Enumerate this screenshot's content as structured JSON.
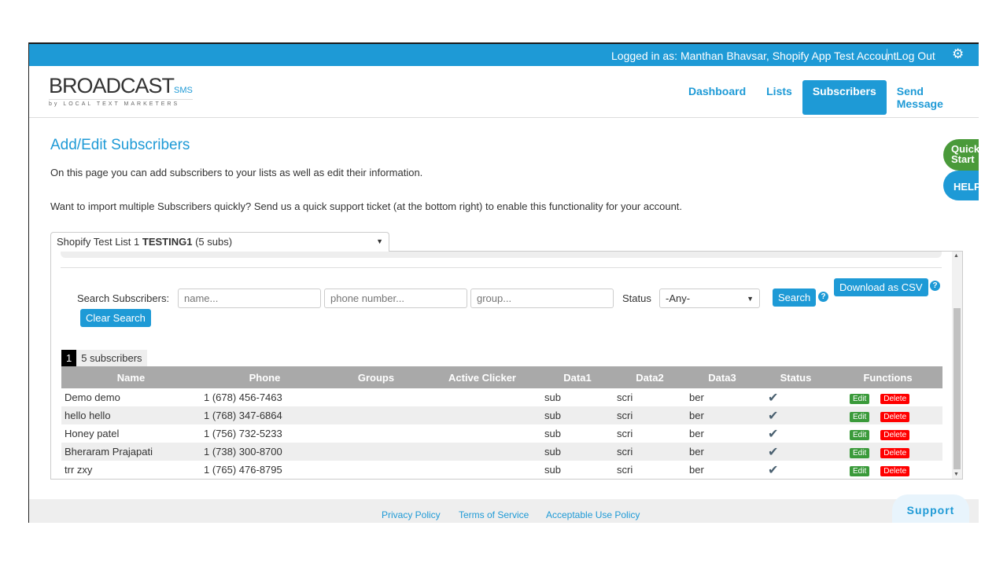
{
  "topbar": {
    "logged_in": "Logged in as: Manthan Bhavsar, Shopify App Test Account",
    "logout": "Log Out",
    "settings_icon": "gear-icon"
  },
  "logo": {
    "brand": "BROADCAST",
    "suffix": "SMS",
    "tagline": "by LOCAL TEXT MARKETERS"
  },
  "nav": [
    {
      "label": "Dashboard"
    },
    {
      "label": "Lists"
    },
    {
      "label": "Subscribers",
      "active": true
    },
    {
      "label": "Send Message"
    }
  ],
  "page": {
    "title": "Add/Edit Subscribers",
    "intro": "On this page you can add subscribers to your lists as well as edit their information.",
    "import_note": "Want to import multiple Subscribers quickly? Send us a quick support ticket (at the bottom right) to enable this functionality for your account."
  },
  "side": {
    "quick_start": "Quick Start",
    "help": "HELP"
  },
  "list_select": {
    "prefix": "Shopify Test List 1",
    "name": "TESTING1",
    "suffix": "(5 subs)"
  },
  "search": {
    "label": "Search Subscribers:",
    "name_placeholder": "name...",
    "phone_placeholder": "phone number...",
    "group_placeholder": "group...",
    "status_label": "Status",
    "status_value": "-Any-",
    "search_button": "Search",
    "csv_button": "Download as CSV",
    "clear_button": "Clear Search"
  },
  "pagination": {
    "page": "1",
    "count": "5 subscribers"
  },
  "table": {
    "columns": [
      "Name",
      "Phone",
      "Groups",
      "Active Clicker",
      "Data1",
      "Data2",
      "Data3",
      "Status",
      "Functions"
    ],
    "rows": [
      {
        "name": "Demo demo",
        "phone": "1 (678) 456-7463",
        "groups": "",
        "active": "",
        "d1": "sub",
        "d2": "scri",
        "d3": "ber",
        "status": "✔"
      },
      {
        "name": "hello hello",
        "phone": "1 (768) 347-6864",
        "groups": "",
        "active": "",
        "d1": "sub",
        "d2": "scri",
        "d3": "ber",
        "status": "✔"
      },
      {
        "name": "Honey patel",
        "phone": "1 (756) 732-5233",
        "groups": "",
        "active": "",
        "d1": "sub",
        "d2": "scri",
        "d3": "ber",
        "status": "✔"
      },
      {
        "name": "Bheraram Prajapati",
        "phone": "1 (738) 300-8700",
        "groups": "",
        "active": "",
        "d1": "sub",
        "d2": "scri",
        "d3": "ber",
        "status": "✔"
      },
      {
        "name": "trr zxy",
        "phone": "1 (765) 476-8795",
        "groups": "",
        "active": "",
        "d1": "sub",
        "d2": "scri",
        "d3": "ber",
        "status": "✔"
      }
    ],
    "edit_label": "Edit",
    "delete_label": "Delete"
  },
  "footer": {
    "privacy": "Privacy Policy",
    "terms": "Terms of Service",
    "aup": "Acceptable Use Policy",
    "support": "Support"
  },
  "colors": {
    "brand": "#1e9ad6",
    "edit": "#3a9a3a",
    "delete": "#ff0000",
    "quick_start": "#4a9a3a"
  }
}
